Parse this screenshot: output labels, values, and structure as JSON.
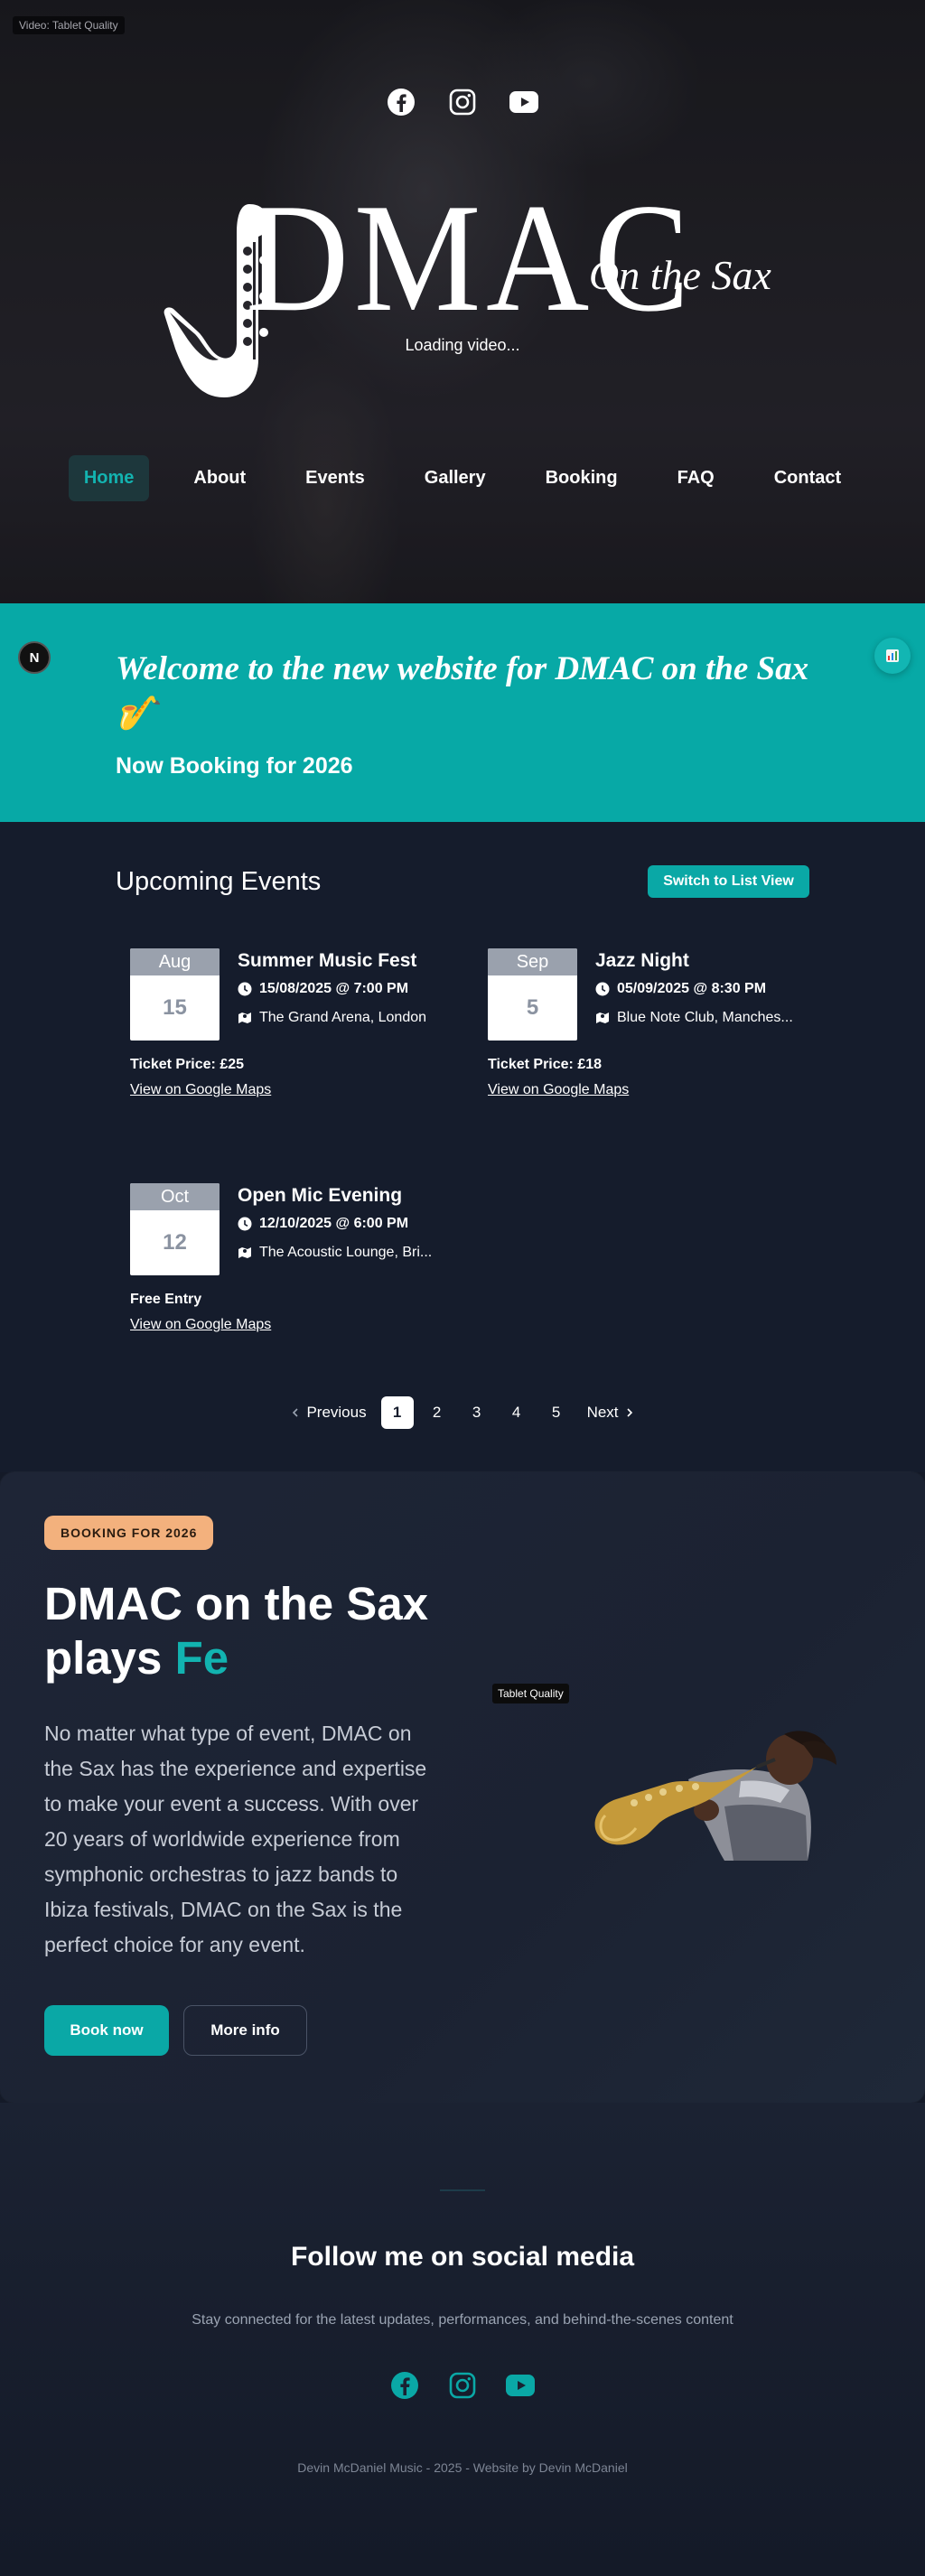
{
  "hero": {
    "video_badge": "Video: Tablet Quality",
    "social_icons": [
      "facebook-icon",
      "instagram-icon",
      "youtube-icon"
    ],
    "logo_main": "DMAC",
    "logo_sub": "On the Sax",
    "loading_text": "Loading video...",
    "nav": [
      {
        "label": "Home",
        "active": true
      },
      {
        "label": "About",
        "active": false
      },
      {
        "label": "Events",
        "active": false
      },
      {
        "label": "Gallery",
        "active": false
      },
      {
        "label": "Booking",
        "active": false
      },
      {
        "label": "FAQ",
        "active": false
      },
      {
        "label": "Contact",
        "active": false
      }
    ]
  },
  "welcome": {
    "title": "Welcome to the new website for DMAC on the Sax 🎷",
    "subtitle": "Now Booking for 2026",
    "n_badge": "N",
    "accessibility_icon": "chart-icon"
  },
  "events": {
    "title": "Upcoming Events",
    "switch_label": "Switch to List View",
    "items": [
      {
        "month": "Aug",
        "day": "15",
        "name": "Summer Music Fest",
        "when": "15/08/2025 @ 7:00 PM",
        "where": "The Grand Arena, London",
        "price": "Ticket Price: £25",
        "map": "View on Google Maps"
      },
      {
        "month": "Sep",
        "day": "5",
        "name": "Jazz Night",
        "when": "05/09/2025 @ 8:30 PM",
        "where": "Blue Note Club, Manches...",
        "price": "Ticket Price: £18",
        "map": "View on Google Maps"
      },
      {
        "month": "Oct",
        "day": "12",
        "name": "Open Mic Evening",
        "when": "12/10/2025 @ 6:00 PM",
        "where": "The Acoustic Lounge, Bri...",
        "price": "Free Entry",
        "map": "View on Google Maps"
      }
    ],
    "pagination": {
      "previous": "Previous",
      "pages": [
        "1",
        "2",
        "3",
        "4",
        "5"
      ],
      "current": "1",
      "next": "Next"
    }
  },
  "booking": {
    "badge": "BOOKING FOR 2026",
    "title_line1": "DMAC on the Sax",
    "title_line2": "plays",
    "title_accent": "Fe",
    "description": "No matter what type of event, DMAC on the Sax has the experience and expertise to make your event a success. With over 20 years of worldwide experience from symphonic orchestras to jazz bands to Ibiza festivals, DMAC on the Sax is the perfect choice for any event.",
    "book_now": "Book now",
    "more_info": "More info",
    "quality_badge": "Tablet Quality"
  },
  "social": {
    "title": "Follow me on social media",
    "subtitle": "Stay connected for the latest updates, performances, and behind-the-scenes content",
    "icons": [
      "facebook-icon",
      "instagram-icon",
      "youtube-icon"
    ],
    "copyright": "Devin McDaniel Music - 2025 - Website by Devin McDaniel"
  },
  "colors": {
    "accent": "#0aa8a6",
    "badge": "#f3b17d",
    "page_bg": "#151c2c"
  }
}
